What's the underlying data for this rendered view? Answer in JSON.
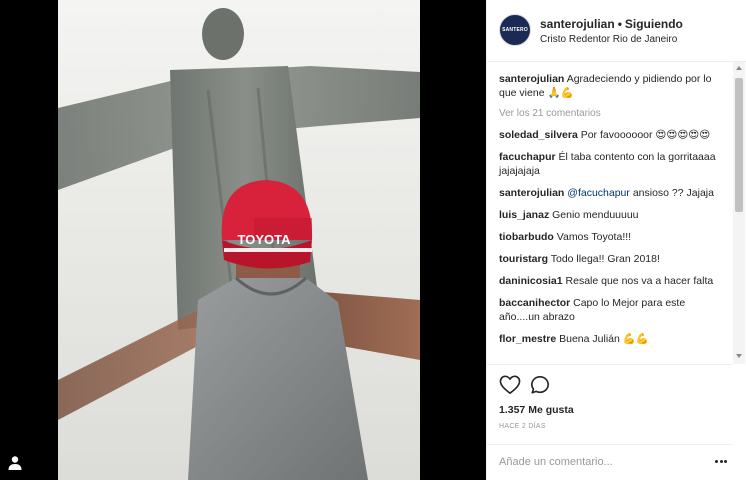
{
  "post": {
    "username": "santerojulian",
    "separator": "•",
    "follow_status": "Siguiendo",
    "location": "Cristo Redentor Rio de Janeiro",
    "avatar_text": "SANTERO",
    "cap_text": "TOYOTA"
  },
  "caption": {
    "username": "santerojulian",
    "text": "Agradeciendo y pidiendo por lo que viene 🙏💪"
  },
  "view_all_label": "Ver los 21 comentarios",
  "comments": [
    {
      "user": "soledad_silvera",
      "text": "Por favoooooor 😍😍😍😍😍"
    },
    {
      "user": "facuchapur",
      "text": "Él taba contento con la gorritaaaa jajajajaja"
    },
    {
      "user": "santerojulian",
      "mention": "@facuchapur",
      "text": " ansioso ?? Jajaja"
    },
    {
      "user": "luis_janaz",
      "text": "Genio menduuuuu"
    },
    {
      "user": "tiobarbudo",
      "text": "Vamos Toyota!!!"
    },
    {
      "user": "touristarg",
      "text": "Todo llega!! Gran 2018!"
    },
    {
      "user": "daninicosia1",
      "text": "Resale que nos va a hacer falta"
    },
    {
      "user": "baccanihector",
      "text": "Capo lo Mejor para este año....un abrazo"
    },
    {
      "user": "flor_mestre",
      "text": "Buena Julián 💪💪"
    }
  ],
  "actions": {
    "likes": "1.357 Me gusta",
    "date": "HACE 2 DÍAS",
    "comment_placeholder": "Añade un comentario..."
  },
  "icons": {
    "like": "heart-icon",
    "comment": "speech-bubble-icon",
    "more": "more-options-icon",
    "tag": "user-tag-icon"
  },
  "colors": {
    "cap_red": "#d8213a",
    "avatar_bg": "#1b2a55",
    "mention": "#003569"
  }
}
